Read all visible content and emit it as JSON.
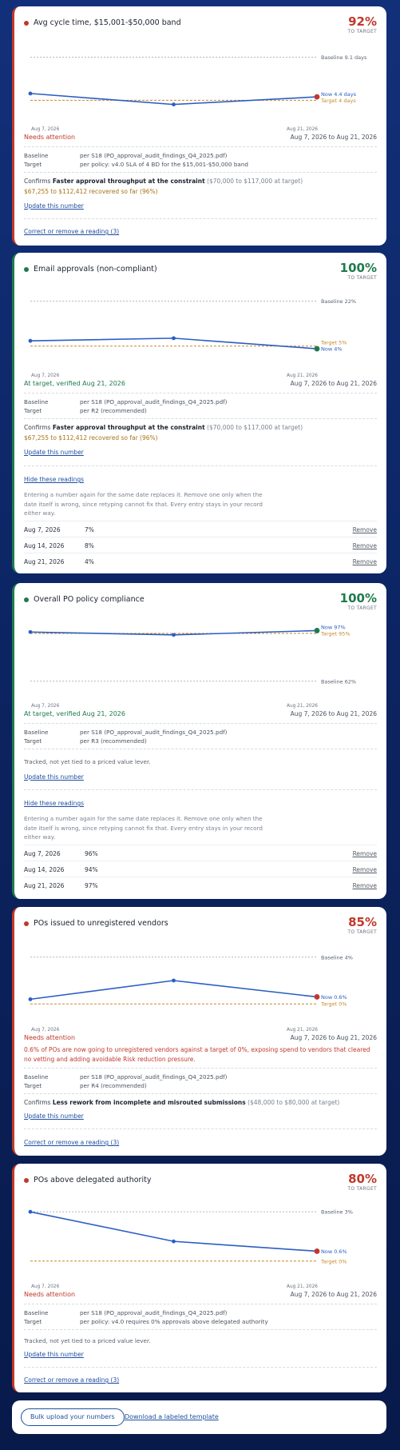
{
  "cards": [
    {
      "title": "Avg cycle time, $15,001-$50,000 band",
      "pct": "92%",
      "pct_sub": "TO TARGET",
      "state": "bad",
      "status": "Needs attention",
      "range": "Aug 7, 2026 to Aug 21, 2026",
      "chart": {
        "baseline_label": "Baseline 9.1 days",
        "now_label": "Now 4.4 days",
        "target_label": "Target 4 days",
        "x_first": "Aug 7, 2026",
        "x_last": "Aug 21, 2026",
        "readings": [
          4.8,
          3.5,
          4.4
        ],
        "baseline": 9.1,
        "target": 4,
        "ylim": [
          2.8,
          10
        ]
      },
      "baseline_label": "Baseline",
      "baseline_value": "per S18 (PO_approval_audit_findings_Q4_2025.pdf)",
      "target_label": "Target",
      "target_value": "per policy: v4.0 SLA of 4 BD for the $15,001-$50,000 band",
      "confirm_prefix": "Confirms ",
      "confirm_bold": "Faster approval throughput at the constraint",
      "confirm_range": " ($70,000 to $117,000 at target)",
      "recovered": "$67,255 to $112,412 recovered so far (96%)",
      "update_link": "Update this number",
      "correct_link": "Correct or remove a reading (3)"
    },
    {
      "title": "Email approvals (non-compliant)",
      "pct": "100%",
      "pct_sub": "TO TARGET",
      "state": "good",
      "status": "At target, verified Aug 21, 2026",
      "range": "Aug 7, 2026 to Aug 21, 2026",
      "chart": {
        "baseline_label": "Baseline 22%",
        "now_label": "Now 4%",
        "target_label": "Target 5%",
        "x_first": "Aug 7, 2026",
        "x_last": "Aug 21, 2026",
        "readings": [
          7,
          8,
          4
        ],
        "baseline": 22,
        "target": 5,
        "ylim": [
          1,
          24
        ]
      },
      "baseline_label": "Baseline",
      "baseline_value": "per S18 (PO_approval_audit_findings_Q4_2025.pdf)",
      "target_label": "Target",
      "target_value": "per R2 (recommended)",
      "confirm_prefix": "Confirms ",
      "confirm_bold": "Faster approval throughput at the constraint",
      "confirm_range": " ($70,000 to $117,000 at target)",
      "recovered": "$67,255 to $112,412 recovered so far (96%)",
      "update_link": "Update this number",
      "hide_link": "Hide these readings",
      "note": "Entering a number again for the same date replaces it. Remove one only when the date itself is wrong, since retyping cannot fix that. Every entry stays in your record either way.",
      "readings": [
        {
          "date": "Aug 7, 2026",
          "value": "7%",
          "remove": "Remove"
        },
        {
          "date": "Aug 14, 2026",
          "value": "8%",
          "remove": "Remove"
        },
        {
          "date": "Aug 21, 2026",
          "value": "4%",
          "remove": "Remove"
        }
      ]
    },
    {
      "title": "Overall PO policy compliance",
      "pct": "100%",
      "pct_sub": "TO TARGET",
      "state": "good",
      "status": "At target, verified Aug 21, 2026",
      "range": "Aug 7, 2026 to Aug 21, 2026",
      "chart": {
        "baseline_label": "Baseline 62%",
        "now_label": "Now 97%",
        "target_label": "Target 95%",
        "x_first": "Aug 7, 2026",
        "x_last": "Aug 21, 2026",
        "readings": [
          96,
          94,
          97
        ],
        "baseline": 62,
        "target": 95,
        "ylim": [
          58,
          100
        ]
      },
      "baseline_label": "Baseline",
      "baseline_value": "per S18 (PO_approval_audit_findings_Q4_2025.pdf)",
      "target_label": "Target",
      "target_value": "per R3 (recommended)",
      "tracked": "Tracked, not yet tied to a priced value lever.",
      "update_link": "Update this number",
      "hide_link": "Hide these readings",
      "note": "Entering a number again for the same date replaces it. Remove one only when the date itself is wrong, since retyping cannot fix that. Every entry stays in your record either way.",
      "readings": [
        {
          "date": "Aug 7, 2026",
          "value": "96%",
          "remove": "Remove"
        },
        {
          "date": "Aug 14, 2026",
          "value": "94%",
          "remove": "Remove"
        },
        {
          "date": "Aug 21, 2026",
          "value": "97%",
          "remove": "Remove"
        }
      ]
    },
    {
      "title": "POs issued to unregistered vendors",
      "pct": "85%",
      "pct_sub": "TO TARGET",
      "state": "bad",
      "status": "Needs attention",
      "range": "Aug 7, 2026 to Aug 21, 2026",
      "warning": "0.6% of POs are now going to unregistered vendors against a target of 0%, exposing spend to vendors that cleared no vetting and adding avoidable Risk reduction pressure.",
      "chart": {
        "baseline_label": "Baseline 4%",
        "now_label": "Now 0.6%",
        "target_label": "Target 0%",
        "x_first": "Aug 7, 2026",
        "x_last": "Aug 21, 2026",
        "readings": [
          0.4,
          2.0,
          0.6
        ],
        "baseline": 4,
        "target": 0,
        "ylim": [
          -0.6,
          4.6
        ]
      },
      "baseline_label": "Baseline",
      "baseline_value": "per S18 (PO_approval_audit_findings_Q4_2025.pdf)",
      "target_label": "Target",
      "target_value": "per R4 (recommended)",
      "confirm_prefix": "Confirms ",
      "confirm_bold": "Less rework from incomplete and misrouted submissions",
      "confirm_range": " ($48,000 to $80,000 at target)",
      "update_link": "Update this number",
      "correct_link": "Correct or remove a reading (3)"
    },
    {
      "title": "POs above delegated authority",
      "pct": "80%",
      "pct_sub": "TO TARGET",
      "state": "bad",
      "status": "Needs attention",
      "range": "Aug 7, 2026 to Aug 21, 2026",
      "chart": {
        "baseline_label": "Baseline 3%",
        "now_label": "Now 0.6%",
        "target_label": "Target 0%",
        "x_first": "Aug 7, 2026",
        "x_last": "Aug 21, 2026",
        "readings": [
          3,
          1.2,
          0.6
        ],
        "baseline": 3,
        "target": 0,
        "ylim": [
          -0.4,
          3.3
        ]
      },
      "baseline_label": "Baseline",
      "baseline_value": "per S18 (PO_approval_audit_findings_Q4_2025.pdf)",
      "target_label": "Target",
      "target_value": "per policy: v4.0 requires 0% approvals above delegated authority",
      "tracked": "Tracked, not yet tied to a priced value lever.",
      "update_link": "Update this number",
      "correct_link": "Correct or remove a reading (3)"
    }
  ],
  "footer": {
    "bulk_upload": "Bulk upload your numbers",
    "download_template": "Download a labeled template"
  },
  "colors": {
    "bad": "#c0392b",
    "good": "#1e7a4c",
    "line": "#2a5ec4",
    "target": "#c8872a",
    "baseline": "#9aa0a8"
  }
}
